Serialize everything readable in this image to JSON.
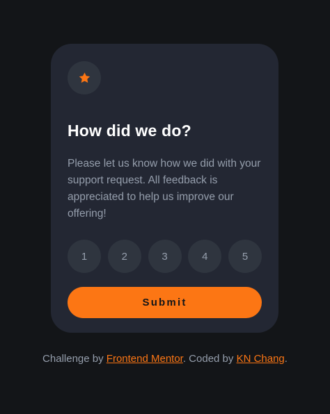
{
  "card": {
    "icon": "star-icon",
    "title": "How did we do?",
    "description": "Please let us know how we did with your support request. All feedback is appreciated to help us improve our offering!",
    "ratings": [
      "1",
      "2",
      "3",
      "4",
      "5"
    ],
    "submit_label": "Submit"
  },
  "attribution": {
    "prefix": "Challenge by ",
    "challenge_link": "Frontend Mentor",
    "middle": ". Coded by ",
    "author_link": "KN Chang",
    "suffix": "."
  },
  "colors": {
    "background": "#131518",
    "card": "#232733",
    "accent": "#fc7614",
    "muted_text": "#959eac",
    "circle": "#2f353f"
  }
}
